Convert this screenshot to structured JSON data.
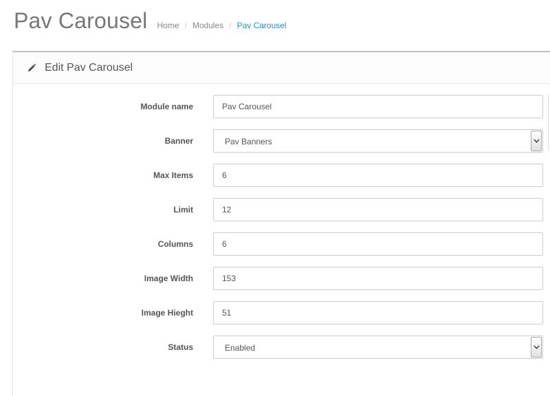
{
  "page": {
    "title": "Pav Carousel",
    "breadcrumb": [
      "Home",
      "Modules",
      "Pav Carousel"
    ]
  },
  "panel": {
    "icon": "pencil-icon",
    "title": "Edit Pav Carousel"
  },
  "form": {
    "module_name": {
      "label": "Module name",
      "value": "Pav Carousel"
    },
    "banner": {
      "label": "Banner",
      "value": "Pav Banners"
    },
    "max_items": {
      "label": "Max Items",
      "value": "6"
    },
    "limit": {
      "label": "Limit",
      "value": "12"
    },
    "columns": {
      "label": "Columns",
      "value": "6"
    },
    "image_width": {
      "label": "Image Width",
      "value": "153"
    },
    "image_height": {
      "label": "Image Hieght",
      "value": "51"
    },
    "status": {
      "label": "Status",
      "value": "Enabled"
    }
  },
  "colors": {
    "accent": "#1e91cf",
    "title": "#777777",
    "border": "#cccccc"
  }
}
